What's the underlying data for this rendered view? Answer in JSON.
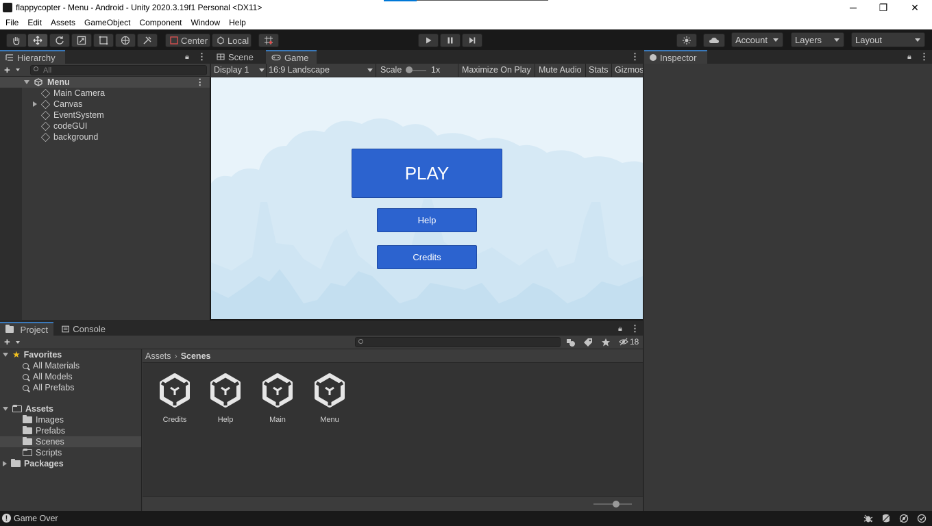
{
  "window": {
    "title": "flappycopter - Menu - Android - Unity 2020.3.19f1 Personal <DX11>",
    "minimize": "─",
    "maximize": "❐",
    "close": "✕"
  },
  "menubar": [
    "File",
    "Edit",
    "Assets",
    "GameObject",
    "Component",
    "Window",
    "Help"
  ],
  "toolbar": {
    "pivot_label": "Center",
    "space_label": "Local",
    "account_label": "Account",
    "layers_label": "Layers",
    "layout_label": "Layout"
  },
  "hierarchy": {
    "tab_label": "Hierarchy",
    "search_placeholder": "All",
    "scene_name": "Menu",
    "items": [
      "Main Camera",
      "Canvas",
      "EventSystem",
      "codeGUI",
      "background"
    ]
  },
  "center_tabs": {
    "scene_label": "Scene",
    "game_label": "Game"
  },
  "game_toolbar": {
    "display": "Display 1",
    "aspect": "16:9 Landscape",
    "scale_label": "Scale",
    "scale_value": "1x",
    "maximize_on_play": "Maximize On Play",
    "mute_audio": "Mute Audio",
    "stats": "Stats",
    "gizmos": "Gizmos"
  },
  "game_ui": {
    "play_label": "PLAY",
    "help_label": "Help",
    "credits_label": "Credits"
  },
  "inspector": {
    "tab_label": "Inspector"
  },
  "project": {
    "project_tab": "Project",
    "console_tab": "Console",
    "hidden_count": "18",
    "favorites_label": "Favorites",
    "favorites": [
      "All Materials",
      "All Models",
      "All Prefabs"
    ],
    "assets_label": "Assets",
    "asset_folders": [
      "Images",
      "Prefabs",
      "Scenes",
      "Scripts"
    ],
    "packages_label": "Packages",
    "breadcrumb": [
      "Assets",
      "Scenes"
    ],
    "scenes": [
      "Credits",
      "Help",
      "Main",
      "Menu"
    ]
  },
  "status": {
    "message": "Game Over"
  },
  "colors": {
    "accent": "#3a79bb",
    "game_button": "#2c63cf",
    "sky": "#e8f3fa"
  }
}
